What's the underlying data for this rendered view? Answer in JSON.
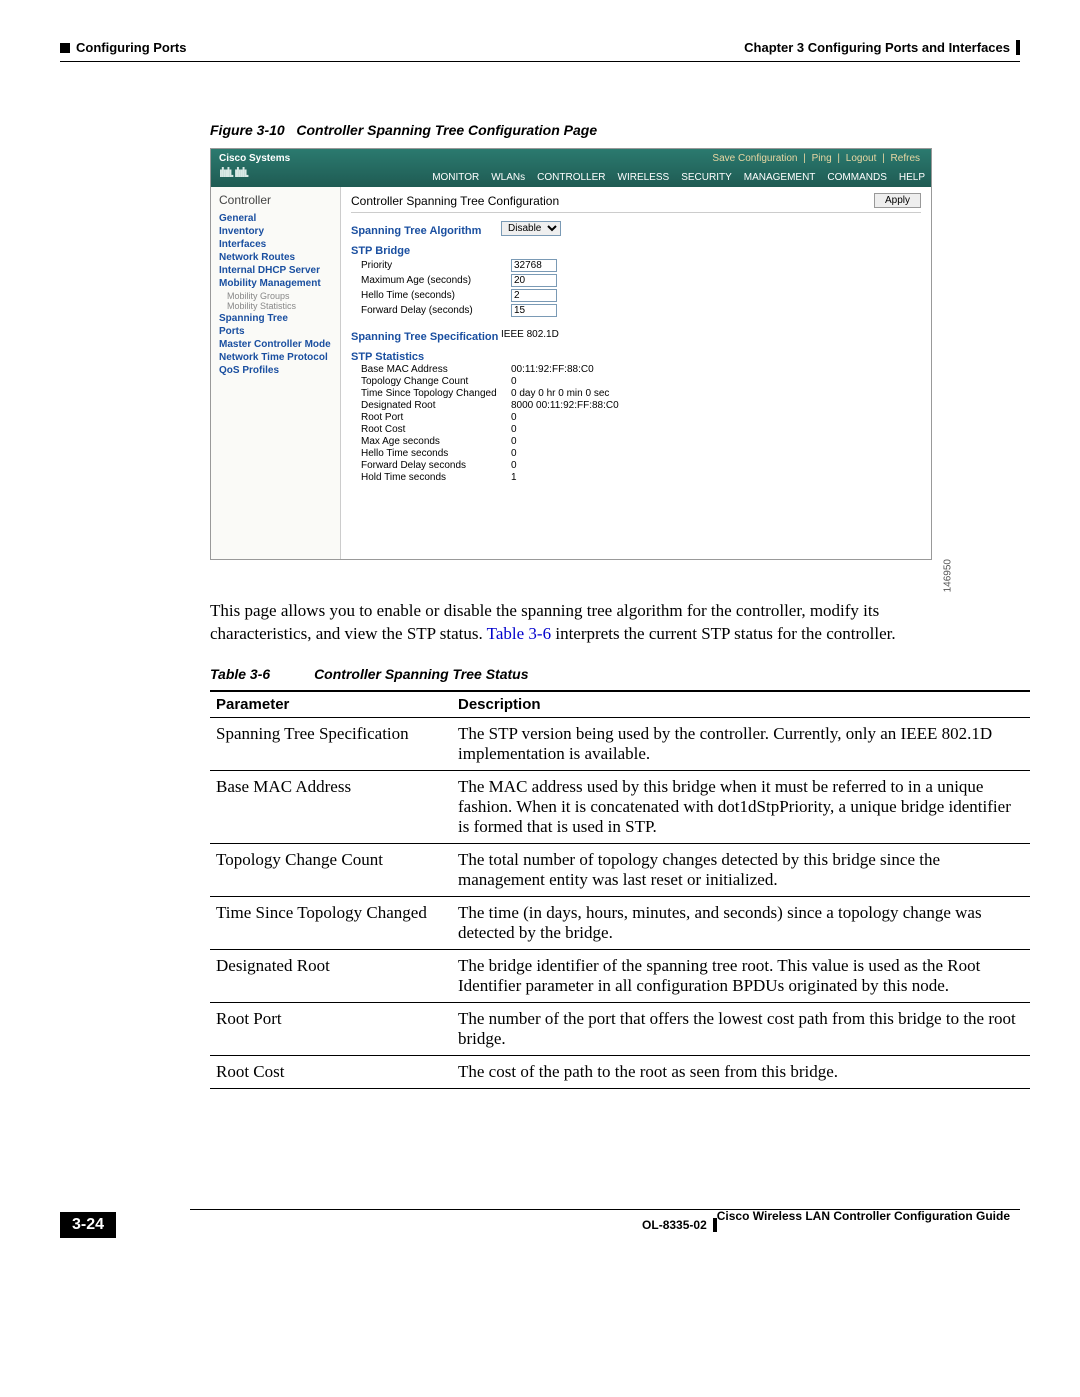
{
  "header": {
    "chapter": "Chapter 3    Configuring Ports and Interfaces",
    "section": "Configuring Ports"
  },
  "figure": {
    "label": "Figure 3-10",
    "title": "Controller Spanning Tree Configuration Page",
    "imageId": "146950"
  },
  "ui": {
    "brand": "Cisco Systems",
    "topLinks": [
      "Save Configuration",
      "Ping",
      "Logout",
      "Refres"
    ],
    "menu": [
      "MONITOR",
      "WLANs",
      "CONTROLLER",
      "WIRELESS",
      "SECURITY",
      "MANAGEMENT",
      "COMMANDS",
      "HELP"
    ],
    "sidebar": {
      "head": "Controller",
      "items": [
        "General",
        "Inventory",
        "Interfaces",
        "Network Routes",
        "Internal DHCP Server",
        "Mobility Management"
      ],
      "mobility_sub": [
        "Mobility Groups",
        "Mobility Statistics"
      ],
      "items2": [
        "Spanning Tree",
        "Ports",
        "Master Controller Mode",
        "Network Time Protocol",
        "QoS Profiles"
      ]
    },
    "pageTitle": "Controller Spanning Tree Configuration",
    "applyLabel": "Apply",
    "algLabel": "Spanning Tree Algorithm",
    "algValue": "Disable",
    "bridgeLabel": "STP Bridge",
    "bridge": {
      "priority_l": "Priority",
      "priority": "32768",
      "maxage_l": "Maximum Age (seconds)",
      "maxage": "20",
      "hello_l": "Hello Time (seconds)",
      "hello": "2",
      "fwd_l": "Forward Delay (seconds)",
      "fwd": "15"
    },
    "specLabel": "Spanning Tree Specification",
    "specValue": "IEEE 802.1D",
    "statsLabel": "STP Statistics",
    "stats": [
      {
        "l": "Base MAC Address",
        "v": "00:11:92:FF:88:C0"
      },
      {
        "l": "Topology Change Count",
        "v": "0"
      },
      {
        "l": "Time Since Topology Changed",
        "v": "0 day 0 hr 0 min 0 sec"
      },
      {
        "l": "Designated Root",
        "v": "8000 00:11:92:FF:88:C0"
      },
      {
        "l": "Root Port",
        "v": "0"
      },
      {
        "l": "Root Cost",
        "v": "0"
      },
      {
        "l": "Max Age seconds",
        "v": "0"
      },
      {
        "l": "Hello Time seconds",
        "v": "0"
      },
      {
        "l": "Forward Delay seconds",
        "v": "0"
      },
      {
        "l": "Hold Time seconds",
        "v": "1"
      }
    ]
  },
  "bodyText": {
    "part1": "This page allows you to enable or disable the spanning tree algorithm for the controller, modify its characteristics, and view the STP status.",
    "link": "Table 3-6",
    "part2": " interprets the current STP status for the controller."
  },
  "tableCaption": {
    "num": "Table 3-6",
    "title": "Controller Spanning Tree Status"
  },
  "tableHeaders": {
    "c1": "Parameter",
    "c2": "Description"
  },
  "tableRows": [
    {
      "p": "Spanning Tree Specification",
      "d": "The STP version being used by the controller. Currently, only an IEEE 802.1D implementation is available."
    },
    {
      "p": "Base MAC Address",
      "d": "The MAC address used by this bridge when it must be referred to in a unique fashion. When it is concatenated with dot1dStpPriority, a unique bridge identifier is formed that is used in STP."
    },
    {
      "p": "Topology Change Count",
      "d": "The total number of topology changes detected by this bridge since the management entity was last reset or initialized."
    },
    {
      "p": "Time Since Topology Changed",
      "d": "The time (in days, hours, minutes, and seconds) since a topology change was detected by the bridge."
    },
    {
      "p": "Designated Root",
      "d": "The bridge identifier of the spanning tree root. This value is used as the Root Identifier parameter in all configuration BPDUs originated by this node."
    },
    {
      "p": "Root Port",
      "d": "The number of the port that offers the lowest cost path from this bridge to the root bridge."
    },
    {
      "p": "Root Cost",
      "d": "The cost of the path to the root as seen from this bridge."
    }
  ],
  "footer": {
    "guide": "Cisco Wireless LAN Controller Configuration Guide",
    "pageNum": "3-24",
    "docId": "OL-8335-02"
  }
}
